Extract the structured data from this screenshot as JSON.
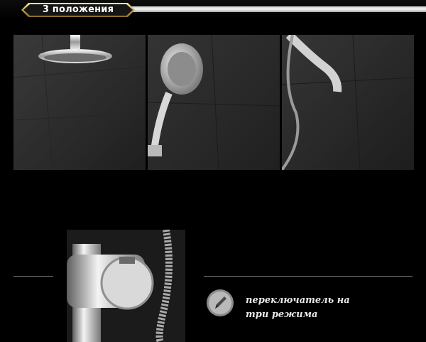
{
  "header": {
    "badge_label": "3 положения"
  },
  "photos": [
    {
      "name": "rain-shower-head-photo"
    },
    {
      "name": "hand-shower-photo"
    },
    {
      "name": "hose-spout-photo"
    },
    {
      "name": "mode-switch-valve-photo"
    }
  ],
  "caption": {
    "icon": "pencil-icon",
    "line1": "переключатель на",
    "line2": "три режима"
  },
  "colors": {
    "background": "#000000",
    "badge_gold": "#c9a45a",
    "badge_dark": "#1a1a1a",
    "text": "#e9e9e9"
  }
}
